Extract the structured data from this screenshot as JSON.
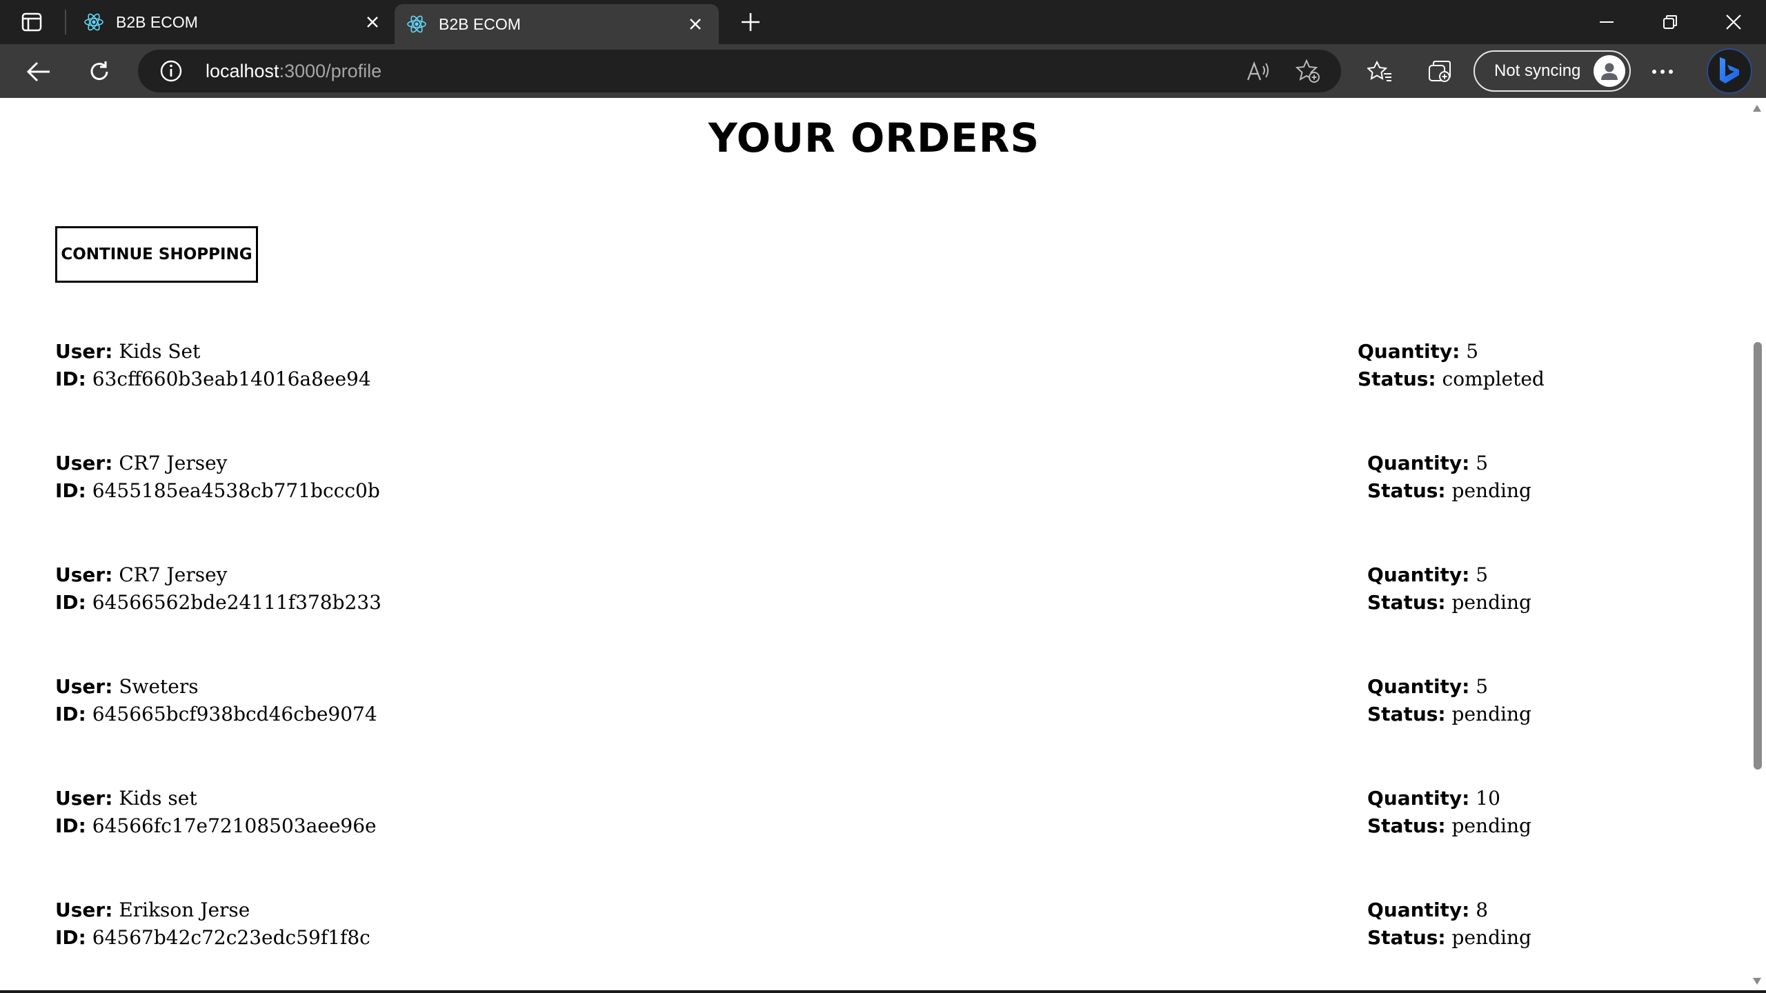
{
  "browser": {
    "tabs": [
      {
        "title": "B2B ECOM",
        "active": false
      },
      {
        "title": "B2B ECOM",
        "active": true
      }
    ],
    "url_host": "localhost",
    "url_path": ":3000/profile",
    "sync_label": "Not syncing"
  },
  "page": {
    "title": "YOUR ORDERS",
    "continue_button": "CONTINUE SHOPPING",
    "labels": {
      "user": "User:",
      "id": "ID:",
      "quantity": "Quantity:",
      "status": "Status:"
    },
    "orders": [
      {
        "user": "Kids Set",
        "id": "63cff660b3eab14016a8ee94",
        "quantity": "5",
        "status": "completed"
      },
      {
        "user": "CR7 Jersey",
        "id": "6455185ea4538cb771bccc0b",
        "quantity": "5",
        "status": "pending"
      },
      {
        "user": "CR7 Jersey",
        "id": "64566562bde24111f378b233",
        "quantity": "5",
        "status": "pending"
      },
      {
        "user": "Sweters",
        "id": "645665bcf938bcd46cbe9074",
        "quantity": "5",
        "status": "pending"
      },
      {
        "user": "Kids set",
        "id": "64566fc17e72108503aee96e",
        "quantity": "10",
        "status": "pending"
      },
      {
        "user": "Erikson Jerse",
        "id": "64567b42c72c23edc59f1f8c",
        "quantity": "8",
        "status": "pending"
      }
    ]
  },
  "colors": {
    "titlebar": "#202020",
    "toolbar": "#3b3b3b",
    "addressbar": "#202020",
    "page_background": "#ffffff",
    "text": "#000000"
  },
  "icons": {
    "tab_actions": "tab-actions-icon",
    "favicon": "react-icon",
    "tab_close": "close-icon",
    "new_tab": "plus-icon",
    "back": "back-arrow-icon",
    "refresh": "refresh-icon",
    "site_info": "info-icon",
    "read_aloud": "read-aloud-icon",
    "add_favorite": "add-favorite-icon",
    "favorites": "favorites-icon",
    "collections": "collections-icon",
    "more": "more-icon",
    "bing": "bing-icon"
  }
}
